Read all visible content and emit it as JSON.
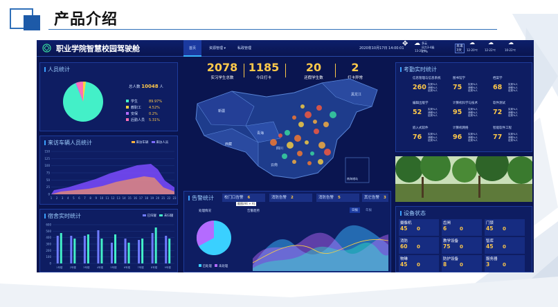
{
  "slide": {
    "title": "产品介绍"
  },
  "header": {
    "title": "职业学院智慧校园驾驶舱",
    "nav": [
      "首页",
      "资源管理",
      "私政管理"
    ],
    "datetime": "2020年10月17日 14:00:01",
    "weather": [
      {
        "label": "多云",
        "sub": "13-20℃"
      },
      {
        "label": "风力3-4级",
        "sub": "27%"
      },
      {
        "label": "未来",
        "sub": "3天"
      },
      {
        "label": "",
        "sub": "12-20℃"
      },
      {
        "label": "",
        "sub": "12-22℃"
      },
      {
        "label": "",
        "sub": "10-22℃"
      }
    ]
  },
  "personnel": {
    "title": "人员统计",
    "total_label": "总人数",
    "total": "10048",
    "unit": "人",
    "legend": [
      {
        "name": "学生",
        "value": "89.97%",
        "color": "#43f0c8"
      },
      {
        "name": "教职工",
        "value": "4.52%",
        "color": "#ffd23f"
      },
      {
        "name": "安保",
        "value": "0.2%",
        "color": "#b46bff"
      },
      {
        "name": "后勤人员",
        "value": "5.31%",
        "color": "#ff6fb5"
      }
    ]
  },
  "visitors": {
    "title": "来访车辆人员统计",
    "legend": [
      "来访车辆",
      "来访人员"
    ],
    "y_ticks": [
      "150",
      "125",
      "100",
      "75",
      "50",
      "25",
      "0"
    ],
    "x_ticks": [
      "1",
      "2",
      "3",
      "4",
      "5",
      "6",
      "7",
      "8",
      "9",
      "10",
      "11",
      "12",
      "13",
      "14",
      "15",
      "16",
      "17",
      "18",
      "19",
      "20",
      "21",
      "22",
      "23"
    ]
  },
  "dorm": {
    "title": "宿舍实时统计",
    "legend": [
      "已归寝",
      "未归寝"
    ],
    "y_ticks": [
      "600",
      "500",
      "400",
      "300",
      "200",
      "100",
      "0"
    ],
    "x_ticks": [
      "1号楼",
      "2号楼",
      "3号楼",
      "4号楼",
      "5号楼",
      "6号楼",
      "7号楼",
      "8号楼",
      "9号楼"
    ]
  },
  "stats": [
    {
      "value": "2078",
      "label": "实习学生总数"
    },
    {
      "value": "1185",
      "label": "今日打卡"
    },
    {
      "value": "20",
      "label": "还假学生数"
    },
    {
      "value": "2",
      "label": "打卡异常"
    }
  ],
  "map": {
    "labels": [
      "新疆",
      "西藏",
      "青海",
      "四川",
      "云南",
      "黑龙江",
      "南海诸岛"
    ]
  },
  "alarms": {
    "title": "告警统计",
    "items": [
      {
        "label": "校门口告警",
        "value": "6"
      },
      {
        "label": "消防告警",
        "value": "2"
      },
      {
        "label": "消防告警",
        "value": "5"
      },
      {
        "label": "其它告警",
        "value": "3"
      }
    ],
    "tooltip": "截图(Alt + A)",
    "pie_title": "处理情况",
    "trend_title": "告警趋势",
    "tabs": [
      "日报",
      "年报"
    ],
    "pie_legend": [
      "已处理",
      "未处理"
    ]
  },
  "attendance": {
    "title": "考勤实时统计",
    "sub_labels": [
      "实到%人",
      "请假%人",
      "迟到%人"
    ],
    "items": [
      {
        "label": "信息管理与信息系统",
        "value": "260"
      },
      {
        "label": "图书馆学",
        "value": "75"
      },
      {
        "label": "档案学",
        "value": "68"
      },
      {
        "label": "编辑出版学",
        "value": "52"
      },
      {
        "label": "计算机科学与技术",
        "value": "95"
      },
      {
        "label": "软件测试",
        "value": "72"
      },
      {
        "label": "嵌入式软件",
        "value": "76"
      },
      {
        "label": "计算机网络",
        "value": "96"
      },
      {
        "label": "智能软件工程",
        "value": "77"
      }
    ]
  },
  "devices": {
    "title": "设备状态",
    "items": [
      {
        "label": "摄像机",
        "v1": "45",
        "v2": "0"
      },
      {
        "label": "齿闸",
        "v1": "6",
        "v2": "0"
      },
      {
        "label": "门禁",
        "v1": "45",
        "v2": "0"
      },
      {
        "label": "消防",
        "v1": "60",
        "v2": "0"
      },
      {
        "label": "教学设备",
        "v1": "75",
        "v2": "0"
      },
      {
        "label": "智库",
        "v1": "45",
        "v2": "0"
      },
      {
        "label": "物琳",
        "v1": "45",
        "v2": "0"
      },
      {
        "label": "防护设备",
        "v1": "8",
        "v2": "0"
      },
      {
        "label": "服务器",
        "v1": "3",
        "v2": "0"
      }
    ]
  }
}
